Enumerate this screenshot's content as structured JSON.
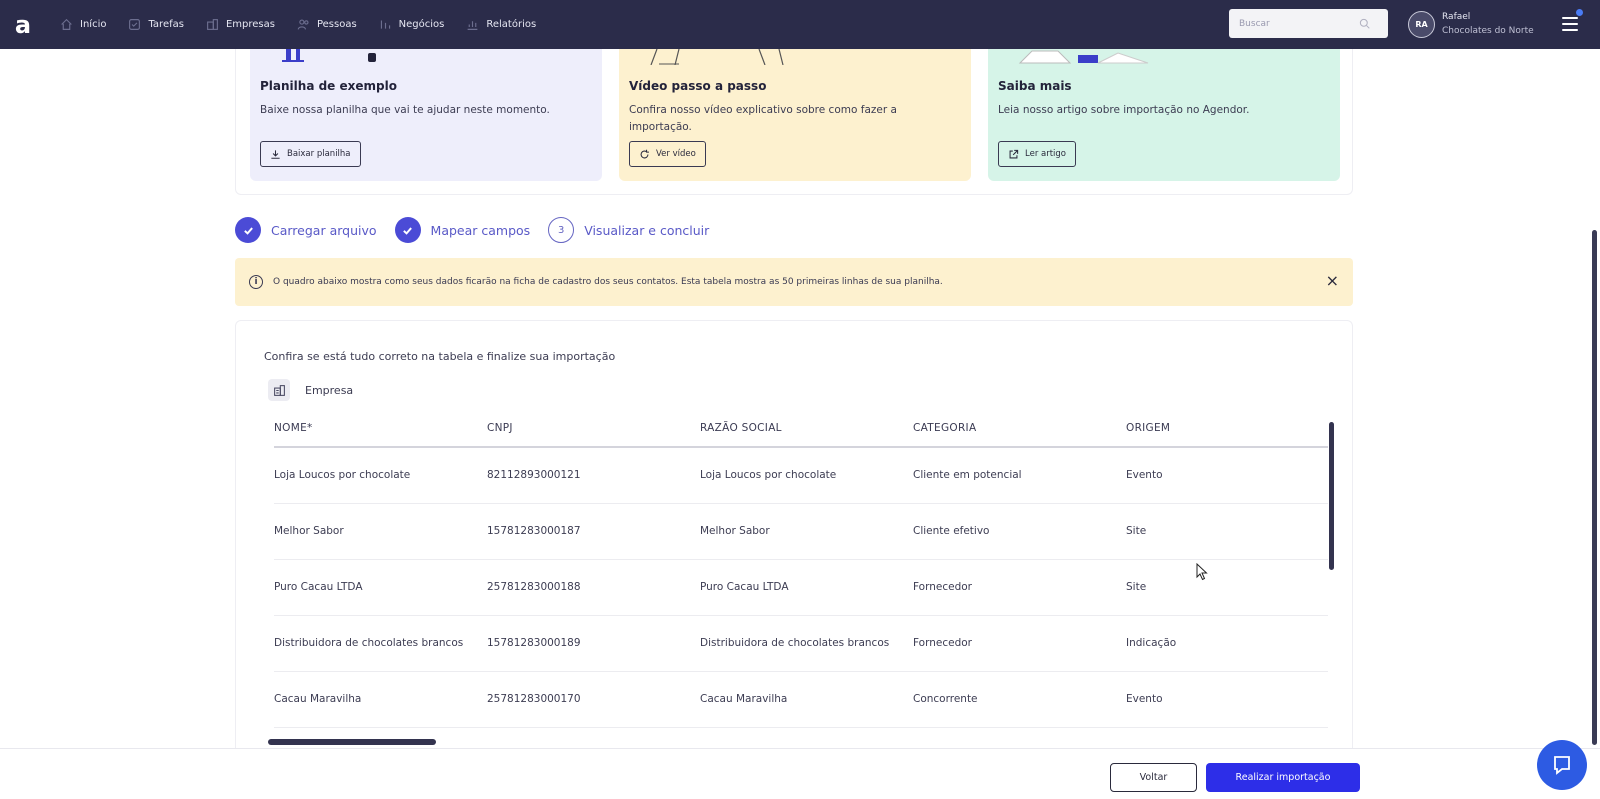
{
  "nav": {
    "logo": "a",
    "items": [
      {
        "label": "Início",
        "icon": "home-icon"
      },
      {
        "label": "Tarefas",
        "icon": "tasks-icon"
      },
      {
        "label": "Empresas",
        "icon": "building-icon"
      },
      {
        "label": "Pessoas",
        "icon": "people-icon"
      },
      {
        "label": "Negócios",
        "icon": "deals-icon"
      },
      {
        "label": "Relatórios",
        "icon": "reports-icon"
      }
    ],
    "search_placeholder": "Buscar",
    "user": {
      "initials": "RA",
      "name": "Rafael",
      "company": "Chocolates do Norte"
    }
  },
  "cards": [
    {
      "title": "Planilha de exemplo",
      "desc": "Baixe nossa planilha que vai te ajudar neste momento.",
      "button": "Baixar planilha",
      "icon": "download-icon"
    },
    {
      "title": "Vídeo passo a passo",
      "desc": "Confira nosso vídeo explicativo sobre como fazer a importação.",
      "button": "Ver vídeo",
      "icon": "replay-icon"
    },
    {
      "title": "Saiba mais",
      "desc": "Leia nosso artigo sobre importação no Agendor.",
      "button": "Ler artigo",
      "icon": "external-link-icon"
    }
  ],
  "steps": [
    {
      "label": "Carregar arquivo",
      "state": "done"
    },
    {
      "label": "Mapear campos",
      "state": "done"
    },
    {
      "number": "3",
      "label": "Visualizar e concluir",
      "state": "current"
    }
  ],
  "alert": {
    "text": "O quadro abaixo mostra como seus dados ficarão na ficha de cadastro dos seus contatos. Esta tabela mostra as 50 primeiras linhas de sua planilha.",
    "close": "×"
  },
  "panel": {
    "title": "Confira se está tudo correto na tabela e finalize sua importação",
    "entity": "Empresa"
  },
  "table": {
    "headers": [
      "NOME*",
      "CNPJ",
      "RAZÃO SOCIAL",
      "CATEGORIA",
      "ORIGEM"
    ],
    "rows": [
      [
        "Loja Loucos por chocolate",
        "82112893000121",
        "Loja Loucos por chocolate",
        "Cliente em potencial",
        "Evento"
      ],
      [
        "Melhor Sabor",
        "15781283000187",
        "Melhor Sabor",
        "Cliente efetivo",
        "Site"
      ],
      [
        "Puro Cacau LTDA",
        "25781283000188",
        "Puro Cacau LTDA",
        "Fornecedor",
        "Site"
      ],
      [
        "Distribuidora de chocolates brancos",
        "15781283000189",
        "Distribuidora de chocolates brancos",
        "Fornecedor",
        "Indicação"
      ],
      [
        "Cacau Maravilha",
        "25781283000170",
        "Cacau Maravilha",
        "Concorrente",
        "Evento"
      ]
    ]
  },
  "footer": {
    "back": "Voltar",
    "import": "Realizar importação"
  },
  "colors": {
    "nav_bg": "#2b2c4a",
    "primary": "#2d2ee8",
    "step": "#4b4bd6",
    "alert_bg": "#fdf1cf",
    "card_blue": "#eeeefb",
    "card_yellow": "#fdf1cf",
    "card_green": "#d6f4e8"
  }
}
